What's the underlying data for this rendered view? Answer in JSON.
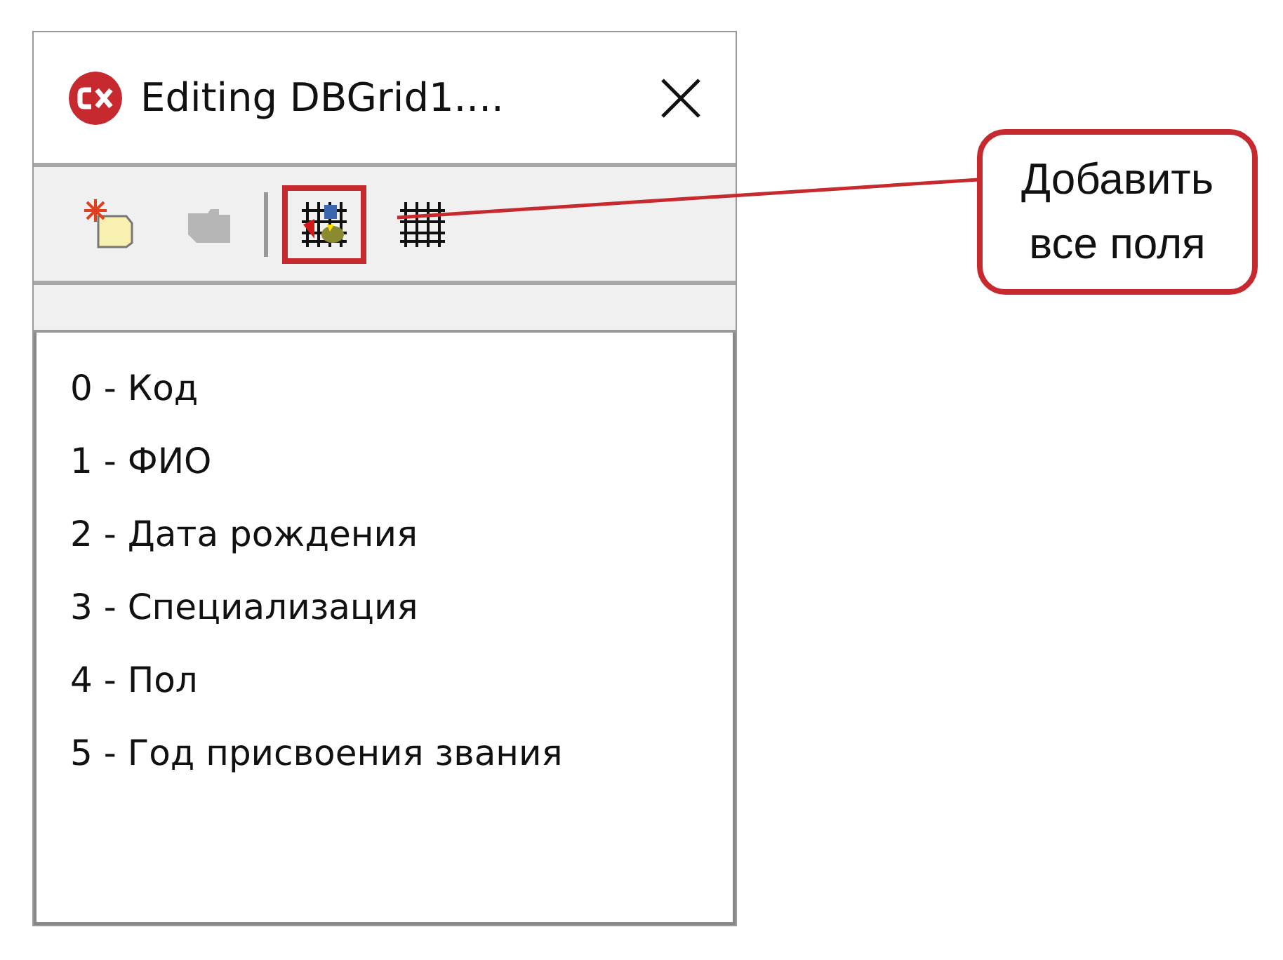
{
  "window": {
    "title": "Editing DBGrid1...."
  },
  "toolbar": {
    "buttons": [
      {
        "kind": "new",
        "disabled": false,
        "highlighted": false
      },
      {
        "kind": "delete",
        "disabled": true,
        "highlighted": false
      },
      {
        "kind": "add-all",
        "disabled": false,
        "highlighted": true
      },
      {
        "kind": "grid",
        "disabled": false,
        "highlighted": false
      }
    ]
  },
  "items": [
    "0 - Код",
    "1 - ФИО",
    "2 - Дата рождения",
    "3 - Специализация",
    "4 - Пол",
    "5 - Год присвоения звания"
  ],
  "callout": {
    "lines": [
      "Добавить",
      "все поля"
    ]
  }
}
